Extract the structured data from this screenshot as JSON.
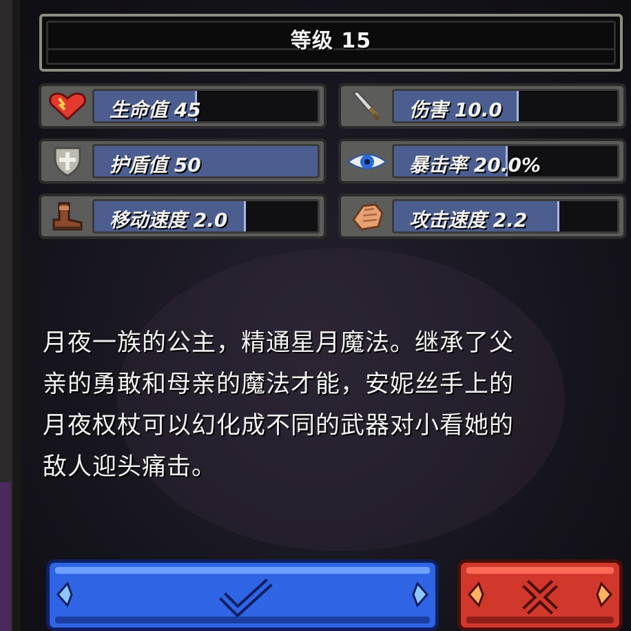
{
  "level": {
    "label": "等级 15"
  },
  "stats": [
    {
      "id": "health",
      "label": "生命值 45",
      "icon": "heart-icon",
      "fill": 0.45
    },
    {
      "id": "damage",
      "label": "伤害 10.0",
      "icon": "sword-icon",
      "fill": 0.55
    },
    {
      "id": "shield",
      "label": "护盾值 50",
      "icon": "shield-icon",
      "fill": 1.0
    },
    {
      "id": "crit",
      "label": "暴击率 20.0%",
      "icon": "eye-icon",
      "fill": 0.5
    },
    {
      "id": "move_speed",
      "label": "移动速度 2.0",
      "icon": "boot-icon",
      "fill": 0.67
    },
    {
      "id": "attack_speed",
      "label": "攻击速度 2.2",
      "icon": "fist-icon",
      "fill": 0.73
    }
  ],
  "description": {
    "lines": [
      "月夜一族的公主，精通星月魔法。继承了父",
      "亲的勇敢和母亲的魔法才能，安妮丝手上的",
      "月夜权杖可以幻化成不同的武器对小看她的",
      "敌人迎头痛击。"
    ]
  },
  "buttons": {
    "confirm": {
      "icon": "checkmark-icon",
      "color": "#2f65e4"
    },
    "cancel": {
      "icon": "x-icon",
      "color": "#d2372b"
    }
  }
}
